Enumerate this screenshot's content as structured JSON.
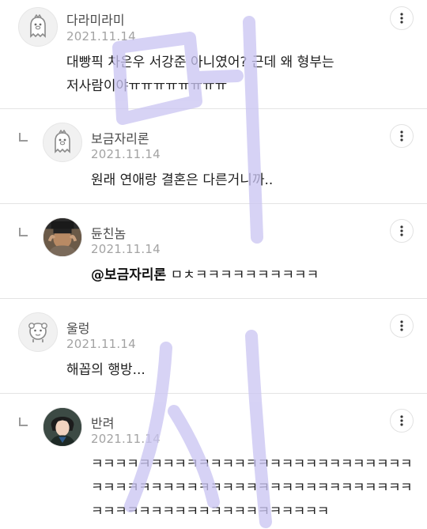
{
  "comments": [
    {
      "nickname": "다라미라미",
      "date": "2021.11.14",
      "body": "대빵픽 차은우 서강준 아니였어? 근데 왜 형부는\n저사람이야ㅠㅠㅠㅠㅠㅠㅠㅠ",
      "avatar_icon": "ghost-mascot-icon",
      "is_reply": false
    },
    {
      "nickname": "보금자리론",
      "date": "2021.11.14",
      "body": "원래 연애랑 결혼은 다른거니까..",
      "avatar_icon": "ghost-mascot-icon",
      "is_reply": true
    },
    {
      "nickname": "듄친놈",
      "date": "2021.11.14",
      "mention": "@보금자리론",
      "body": " ㅁㅊㅋㅋㅋㅋㅋㅋㅋㅋㅋㅋ",
      "avatar_icon": "photo-avatar",
      "is_reply": true
    },
    {
      "nickname": "울렁",
      "date": "2021.11.14",
      "body": "해꼽의 행방...",
      "avatar_icon": "round-mascot-icon",
      "is_reply": false
    },
    {
      "nickname": "반려",
      "date": "2021.11.14",
      "body": "ㅋㅋㅋㅋㅋㅋㅋㅋㅋㅋㅋㅋㅋㅋㅋㅋㅋㅋㅋㅋㅋㅋㅋㅋㅋㅋㅋ\nㅋㅋㅋㅋㅋㅋㅋㅋㅋㅋㅋㅋㅋㅋㅋㅋㅋㅋㅋㅋㅋㅋㅋㅋㅋㅋㅋ\nㅋㅋㅋㅋㅋㅋㅋㅋㅋㅋㅋㅋㅋㅋㅋㅋㅋㅋㅋㅋ",
      "avatar_icon": "illustrated-character-avatar",
      "is_reply": true
    }
  ],
  "more_icon": "vertical-dots-icon",
  "reply_icon": "reply-corner-icon",
  "watermark_text": "머시",
  "colors": {
    "nickname": "#4a4a4a",
    "date": "#a3a3a3",
    "divider": "#e4e4e4",
    "watermark": "#c9c4f2"
  }
}
